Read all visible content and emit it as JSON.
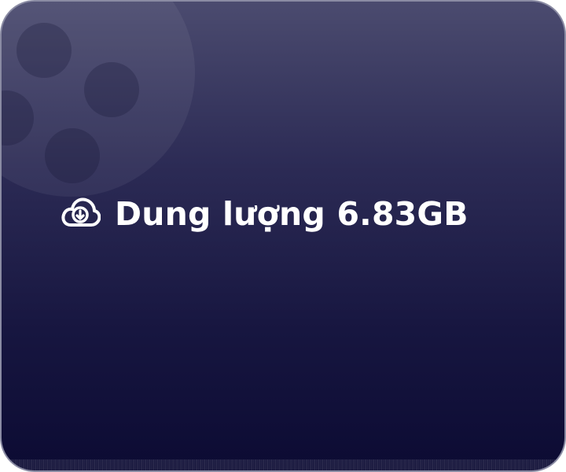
{
  "storage": {
    "icon": "cloud-download-icon",
    "label": "Dung lượng 6.83GB"
  },
  "decoration": {
    "icon": "film-reel-icon"
  },
  "colors": {
    "background_top": "#4b4b6f",
    "background_bottom": "#0c0b33",
    "text": "#ffffff"
  }
}
